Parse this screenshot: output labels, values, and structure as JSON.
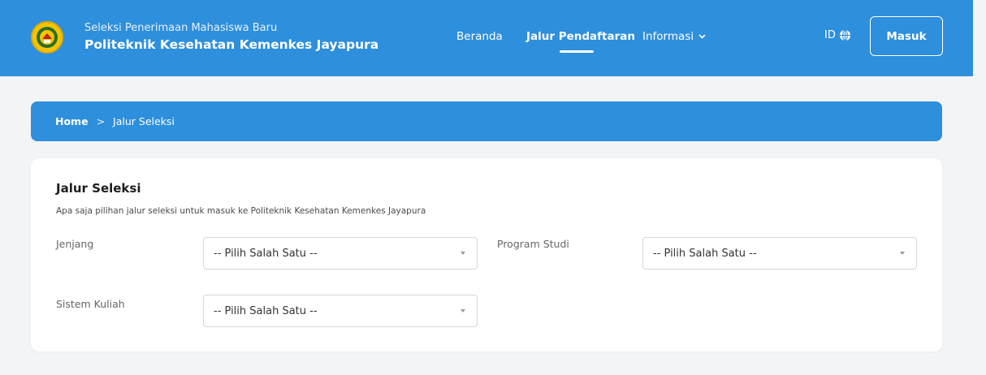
{
  "header": {
    "subtitle": "Seleksi Penerimaan Mahasiswa Baru",
    "title": "Politeknik Kesehatan Kemenkes Jayapura",
    "nav": {
      "beranda": "Beranda",
      "jalur": "Jalur Pendaftaran",
      "informasi": "Informasi"
    },
    "lang": "ID",
    "login": "Masuk"
  },
  "breadcrumb": {
    "home": "Home",
    "sep": ">",
    "current": "Jalur Seleksi"
  },
  "card": {
    "title": "Jalur Seleksi",
    "description": "Apa saja pilihan jalur seleksi untuk masuk ke Politeknik Kesehatan Kemenkes Jayapura",
    "fields": {
      "jenjang": {
        "label": "Jenjang",
        "value": "-- Pilih Salah Satu --"
      },
      "prodi": {
        "label": "Program Studi",
        "value": "-- Pilih Salah Satu --"
      },
      "sistem": {
        "label": "Sistem Kuliah",
        "value": "-- Pilih Salah Satu --"
      }
    }
  },
  "colors": {
    "primary": "#2e8fdc",
    "background": "#f3f4f6",
    "logo": "#f5c400"
  }
}
